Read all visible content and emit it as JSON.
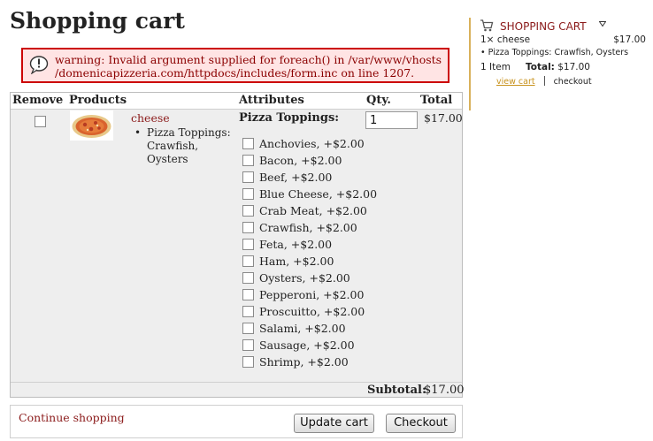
{
  "page": {
    "title": "Shopping cart"
  },
  "warning": {
    "line1": "warning: Invalid argument supplied for foreach() in /var/www/vhosts",
    "line2": "/domenicapizzeria.com/httpdocs/includes/form.inc on line 1207."
  },
  "table": {
    "headers": {
      "remove": "Remove",
      "products": "Products",
      "attributes": "Attributes",
      "qty": "Qty.",
      "total": "Total"
    },
    "item": {
      "name": "cheese",
      "option_label": "Pizza Toppings: Crawfish, Oysters",
      "attribute_title": "Pizza Toppings:",
      "quantity": "1",
      "total": "$17.00",
      "toppings": [
        "Anchovies, +$2.00",
        "Bacon, +$2.00",
        "Beef, +$2.00",
        "Blue Cheese, +$2.00",
        "Crab Meat, +$2.00",
        "Crawfish, +$2.00",
        "Feta, +$2.00",
        "Ham, +$2.00",
        "Oysters, +$2.00",
        "Pepperoni, +$2.00",
        "Proscuitto, +$2.00",
        "Salami, +$2.00",
        "Sausage, +$2.00",
        "Shrimp, +$2.00"
      ]
    },
    "subtotal_label": "Subtotal:",
    "subtotal_value": "$17.00"
  },
  "actions": {
    "continue_label": "Continue shopping",
    "update_label": "Update cart",
    "checkout_label": "Checkout"
  },
  "sidebar": {
    "title": "SHOPPING CART",
    "item_qty_name": "1× cheese",
    "item_price": "$17.00",
    "item_option": "Pizza Toppings: Crawfish, Oysters",
    "count": "1 Item",
    "total_label": "Total:",
    "total_value": "$17.00",
    "view_cart": "view cart",
    "checkout": "checkout"
  },
  "colors": {
    "warning_border": "#cc0000",
    "warning_bg": "#ffe4e4",
    "link": "#8b1a1a",
    "accent": "#d9b15a"
  }
}
